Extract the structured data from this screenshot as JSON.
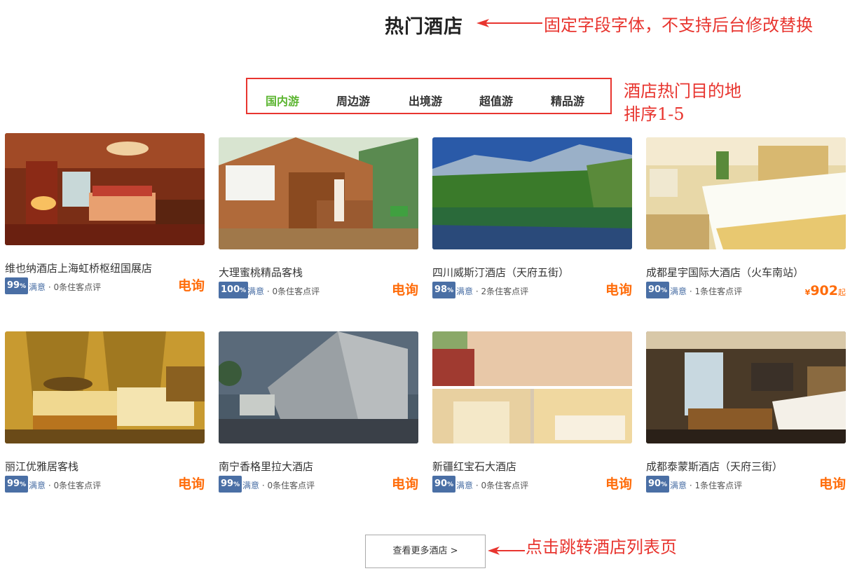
{
  "page": {
    "title": "热门酒店",
    "more_button": "查看更多酒店 >"
  },
  "annotations": {
    "title_note": "固定字段字体，不支持后台修改替换",
    "tabs_note_line1": "酒店热门目的地",
    "tabs_note_line2": "排序1-5",
    "more_note": "点击跳转酒店列表页",
    "color": "#e8352f"
  },
  "tabs": [
    {
      "label": "国内游",
      "active": true
    },
    {
      "label": "周边游",
      "active": false
    },
    {
      "label": "出境游",
      "active": false
    },
    {
      "label": "超值游",
      "active": false
    },
    {
      "label": "精品游",
      "active": false
    }
  ],
  "hotels": [
    {
      "name": "维也纳酒店上海虹桥枢纽国展店",
      "score": "99",
      "percent": "%",
      "satisfied": "满意",
      "reviews": "· 0条住客点评",
      "price": "电询"
    },
    {
      "name": "大理蜜桃精品客栈",
      "score": "100",
      "percent": "%",
      "satisfied": "满意",
      "reviews": "· 0条住客点评",
      "price": "电询"
    },
    {
      "name": "四川威斯汀酒店（天府五街）",
      "score": "98",
      "percent": "%",
      "satisfied": "满意",
      "reviews": "· 2条住客点评",
      "price": "电询"
    },
    {
      "name": "成都星宇国际大酒店（火车南站）",
      "score": "90",
      "percent": "%",
      "satisfied": "满意",
      "reviews": "· 1条住客点评",
      "price_symbol": "¥",
      "price_value": "902",
      "price_suffix": "起"
    },
    {
      "name": "丽江优雅居客栈",
      "score": "99",
      "percent": "%",
      "satisfied": "满意",
      "reviews": "· 0条住客点评",
      "price": "电询"
    },
    {
      "name": "南宁香格里拉大酒店",
      "score": "99",
      "percent": "%",
      "satisfied": "满意",
      "reviews": "· 0条住客点评",
      "price": "电询"
    },
    {
      "name": "新疆红宝石大酒店",
      "score": "90",
      "percent": "%",
      "satisfied": "满意",
      "reviews": "· 0条住客点评",
      "price": "电询"
    },
    {
      "name": "成都泰蒙斯酒店（天府三街）",
      "score": "90",
      "percent": "%",
      "satisfied": "满意",
      "reviews": "· 1条住客点评",
      "price": "电询"
    }
  ],
  "colors": {
    "active_tab": "#5cb531",
    "price": "#ff6c0a",
    "score_badge": "#4a6fa5"
  }
}
